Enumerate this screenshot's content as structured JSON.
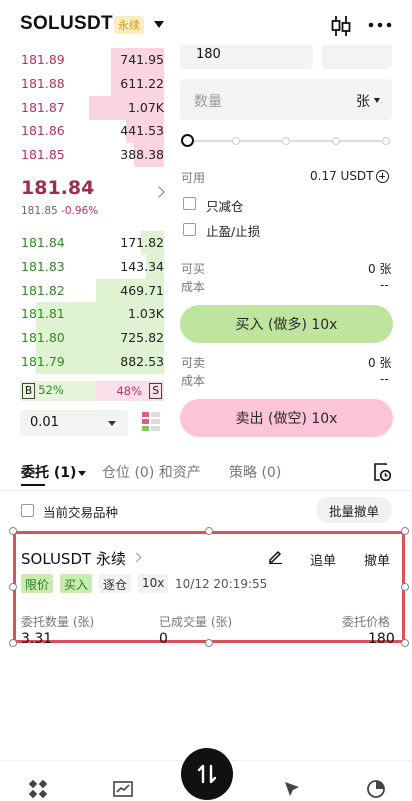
{
  "header": {
    "symbol": "SOLUSDT",
    "contract_type": "永续",
    "icons": [
      "chevron-down-icon",
      "candlestick-chart-icon",
      "more-icon"
    ]
  },
  "orderbook": {
    "asks": [
      {
        "price": "181.89",
        "qty": "741.95",
        "depth": 0.35
      },
      {
        "price": "181.88",
        "qty": "611.22",
        "depth": 0.35
      },
      {
        "price": "181.87",
        "qty": "1.07K",
        "depth": 0.5
      },
      {
        "price": "181.86",
        "qty": "441.53",
        "depth": 0.25
      },
      {
        "price": "181.85",
        "qty": "388.38",
        "depth": 0.2
      }
    ],
    "last_price": "181.84",
    "mark_price": "181.85",
    "change": "-0.96%",
    "bids": [
      {
        "price": "181.84",
        "qty": "171.82",
        "depth": 0.15
      },
      {
        "price": "181.83",
        "qty": "143.34",
        "depth": 0.12
      },
      {
        "price": "181.82",
        "qty": "469.71",
        "depth": 0.45
      },
      {
        "price": "181.81",
        "qty": "1.03K",
        "depth": 0.85
      },
      {
        "price": "181.80",
        "qty": "725.82",
        "depth": 0.85
      },
      {
        "price": "181.79",
        "qty": "882.53",
        "depth": 0.85
      }
    ],
    "buy_tag": "B",
    "buy_ratio": "52%",
    "sell_ratio": "48%",
    "sell_tag": "S",
    "precision": "0.01"
  },
  "form": {
    "price_value": "180",
    "qty_placeholder": "数量",
    "qty_unit": "张",
    "slider_percent": 0,
    "available_label": "可用",
    "available_value": "0.17 USDT",
    "reduce_only": "只减仓",
    "tp_sl": "止盈/止损",
    "can_buy_label": "可买",
    "can_buy_value": "0 张",
    "cost_label": "成本",
    "cost_buy_value": "--",
    "buy_button": "买入 (做多) 10x",
    "can_sell_label": "可卖",
    "can_sell_value": "0 张",
    "cost_sell_value": "--",
    "sell_button": "卖出 (做空) 10x"
  },
  "tabs": {
    "orders": "委托 (1)",
    "positions": "仓位 (0) 和资产",
    "strategies": "策略 (0)"
  },
  "filter": {
    "current_only": "当前交易品种",
    "cancel_all": "批量撤单"
  },
  "order": {
    "title": "SOLUSDT 永续",
    "chase": "追单",
    "cancel": "撤单",
    "type": "限价",
    "side": "买入",
    "margin_mode": "逐仓",
    "leverage": "10x",
    "time": "10/12 20:19:55",
    "qty_label": "委托数量 (张)",
    "qty_value": "3.31",
    "filled_label": "已成交量 (张)",
    "filled_value": "0",
    "price_label": "委托价格",
    "price_value": "180"
  },
  "bottom_nav": [
    "grid-icon",
    "chart-icon",
    "trade-icon",
    "compass-icon",
    "pie-chart-icon"
  ]
}
